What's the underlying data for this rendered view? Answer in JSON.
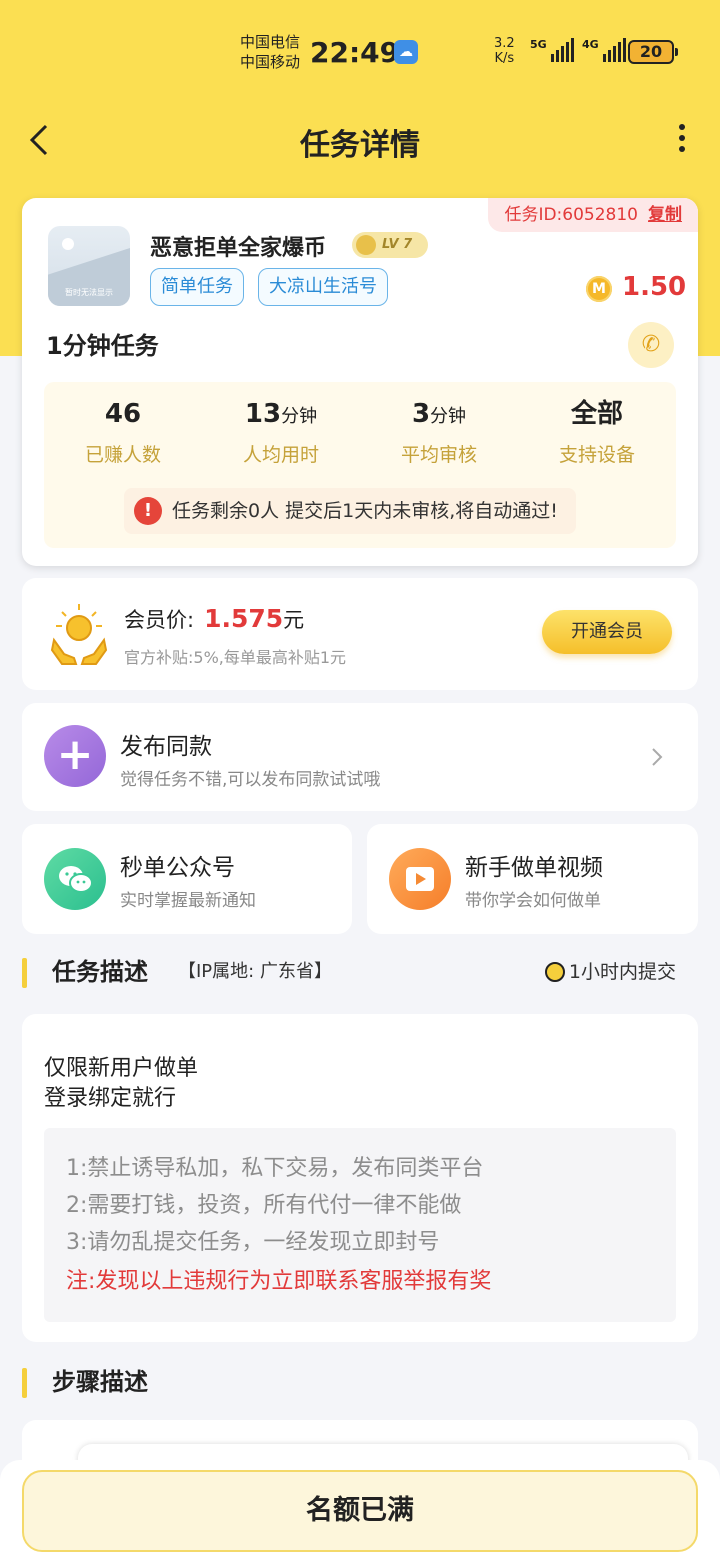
{
  "status_bar": {
    "carrier_1": "中国电信",
    "carrier_2": "中国移动",
    "time": "22:49",
    "net_speed_value": "3.2",
    "net_speed_unit": "K/s",
    "signal_1": "5G",
    "signal_2": "4G",
    "battery": "20"
  },
  "nav": {
    "title": "任务详情"
  },
  "task": {
    "id_label": "任务ID:6052810",
    "copy_label": "复制",
    "thumb_text": "暂时无法显示",
    "name": "恶意拒单全家爆币",
    "level": "LV 7",
    "tags": [
      "简单任务",
      "大凉山生活号"
    ],
    "price": "1.50",
    "duration": "1分钟任务",
    "stats": [
      {
        "num": "46",
        "unit": "",
        "label": "已赚人数"
      },
      {
        "num": "13",
        "unit": "分钟",
        "label": "人均用时"
      },
      {
        "num": "3",
        "unit": "分钟",
        "label": "平均审核"
      },
      {
        "num": "全部",
        "unit": "",
        "label": "支持设备"
      }
    ],
    "notice": "任务剩余0人  提交后1天内未审核,将自动通过!"
  },
  "vip": {
    "label": "会员价:",
    "price": "1.575",
    "unit": "元",
    "sub": "官方补贴:5%,每单最高补贴1元",
    "button": "开通会员"
  },
  "publish": {
    "title": "发布同款",
    "sub": "觉得任务不错,可以发布同款试试哦"
  },
  "wechat": {
    "title": "秒单公众号",
    "sub": "实时掌握最新通知"
  },
  "video": {
    "title": "新手做单视频",
    "sub": "带你学会如何做单"
  },
  "description": {
    "title": "任务描述",
    "ip": "【IP属地: 广东省】",
    "deadline": "1小时内提交",
    "lines": [
      "仅限新用户做单",
      "登录绑定就行"
    ],
    "rules": [
      "1:禁止诱导私加，私下交易，发布同类平台",
      "2:需要打钱，投资，所有代付一律不能做",
      "3:请勿乱提交任务，一经发现立即封号"
    ],
    "warning": "注:发现以上违规行为立即联系客服举报有奖"
  },
  "steps": {
    "title": "步骤描述"
  },
  "bottom": {
    "button": "名额已满"
  },
  "colors": {
    "header_yellow": "#fbdf52",
    "price_red": "#e23a3a",
    "tag_blue": "#2a8bd6"
  }
}
